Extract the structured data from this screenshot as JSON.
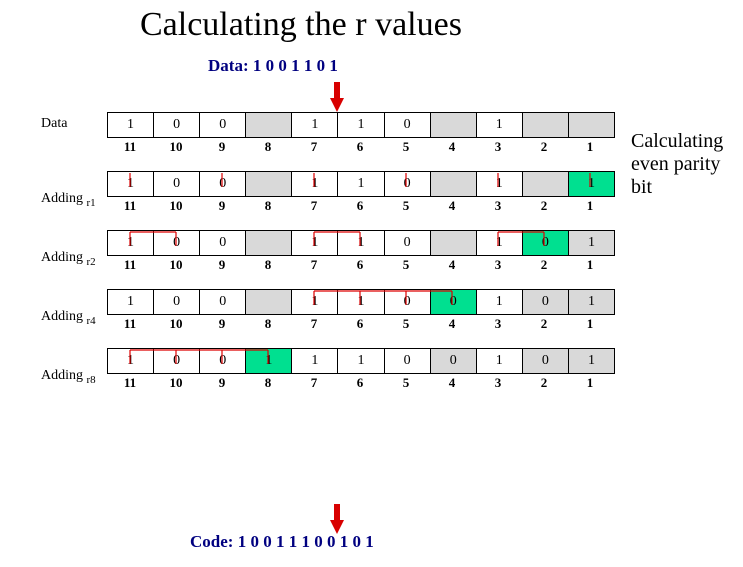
{
  "title": "Calculating the r values",
  "data_label": "Data:  1 0 0 1 1 0 1",
  "code_label": "Code:  1 0 0 1 1 1 0 0 1 0 1",
  "side_note_l1": "Calculating",
  "side_note_l2": "even parity",
  "side_note_l3": "bit",
  "positions": [
    "11",
    "10",
    "9",
    "8",
    "7",
    "6",
    "5",
    "4",
    "3",
    "2",
    "1"
  ],
  "rows": [
    {
      "label": "Data",
      "label_html": "Data",
      "cells": [
        {
          "v": "1"
        },
        {
          "v": "0"
        },
        {
          "v": "0"
        },
        {
          "v": "",
          "c": "gray"
        },
        {
          "v": "1"
        },
        {
          "v": "1"
        },
        {
          "v": "0"
        },
        {
          "v": "",
          "c": "gray"
        },
        {
          "v": "1"
        },
        {
          "v": "",
          "c": "gray"
        },
        {
          "v": "",
          "c": "gray"
        }
      ]
    },
    {
      "label": "Adding r1",
      "label_html": "Adding <span class='sub'>r1</span>",
      "cells": [
        {
          "v": "1"
        },
        {
          "v": "0"
        },
        {
          "v": "0"
        },
        {
          "v": "",
          "c": "gray"
        },
        {
          "v": "1"
        },
        {
          "v": "1"
        },
        {
          "v": "0"
        },
        {
          "v": "",
          "c": "gray"
        },
        {
          "v": "1"
        },
        {
          "v": "",
          "c": "gray"
        },
        {
          "v": "1",
          "c": "green"
        }
      ],
      "checked": [
        11,
        9,
        7,
        5,
        3,
        1
      ]
    },
    {
      "label": "Adding r2",
      "label_html": "Adding <span class='sub'>r2</span>",
      "cells": [
        {
          "v": "1"
        },
        {
          "v": "0"
        },
        {
          "v": "0"
        },
        {
          "v": "",
          "c": "gray"
        },
        {
          "v": "1"
        },
        {
          "v": "1"
        },
        {
          "v": "0"
        },
        {
          "v": "",
          "c": "gray"
        },
        {
          "v": "1"
        },
        {
          "v": "0",
          "c": "green"
        },
        {
          "v": "1",
          "c": "gray"
        }
      ],
      "checked": [
        11,
        10,
        7,
        6,
        3,
        2
      ]
    },
    {
      "label": "Adding r4",
      "label_html": "Adding <span class='sub'>r4</span>",
      "cells": [
        {
          "v": "1"
        },
        {
          "v": "0"
        },
        {
          "v": "0"
        },
        {
          "v": "",
          "c": "gray"
        },
        {
          "v": "1"
        },
        {
          "v": "1"
        },
        {
          "v": "0"
        },
        {
          "v": "0",
          "c": "green"
        },
        {
          "v": "1"
        },
        {
          "v": "0",
          "c": "gray"
        },
        {
          "v": "1",
          "c": "gray"
        }
      ],
      "checked": [
        7,
        6,
        5,
        4
      ]
    },
    {
      "label": "Adding r8",
      "label_html": "Adding <span class='sub'>r8</span>",
      "cells": [
        {
          "v": "1"
        },
        {
          "v": "0"
        },
        {
          "v": "0"
        },
        {
          "v": "1",
          "c": "green"
        },
        {
          "v": "1"
        },
        {
          "v": "1"
        },
        {
          "v": "0"
        },
        {
          "v": "0",
          "c": "gray"
        },
        {
          "v": "1"
        },
        {
          "v": "0",
          "c": "gray"
        },
        {
          "v": "1",
          "c": "gray"
        }
      ],
      "checked": [
        11,
        10,
        9,
        8
      ]
    }
  ],
  "chart_data": {
    "type": "table",
    "title": "Hamming code parity bit calculation (even parity)",
    "data_bits": "1001101",
    "codeword": "10011100101",
    "parity_bits": {
      "r1": 1,
      "r2": 0,
      "r4": 0,
      "r8": 1
    },
    "bit_positions": [
      11,
      10,
      9,
      8,
      7,
      6,
      5,
      4,
      3,
      2,
      1
    ],
    "rows": [
      {
        "name": "Data",
        "values": [
          "1",
          "0",
          "0",
          "",
          "1",
          "1",
          "0",
          "",
          "1",
          "",
          ""
        ]
      },
      {
        "name": "Adding r1",
        "values": [
          "1",
          "0",
          "0",
          "",
          "1",
          "1",
          "0",
          "",
          "1",
          "",
          "1"
        ],
        "checks": [
          11,
          9,
          7,
          5,
          3,
          1
        ]
      },
      {
        "name": "Adding r2",
        "values": [
          "1",
          "0",
          "0",
          "",
          "1",
          "1",
          "0",
          "",
          "1",
          "0",
          "1"
        ],
        "checks": [
          11,
          10,
          7,
          6,
          3,
          2
        ]
      },
      {
        "name": "Adding r4",
        "values": [
          "1",
          "0",
          "0",
          "",
          "1",
          "1",
          "0",
          "0",
          "1",
          "0",
          "1"
        ],
        "checks": [
          7,
          6,
          5,
          4
        ]
      },
      {
        "name": "Adding r8",
        "values": [
          "1",
          "0",
          "0",
          "1",
          "1",
          "1",
          "0",
          "0",
          "1",
          "0",
          "1"
        ],
        "checks": [
          11,
          10,
          9,
          8
        ]
      }
    ]
  }
}
